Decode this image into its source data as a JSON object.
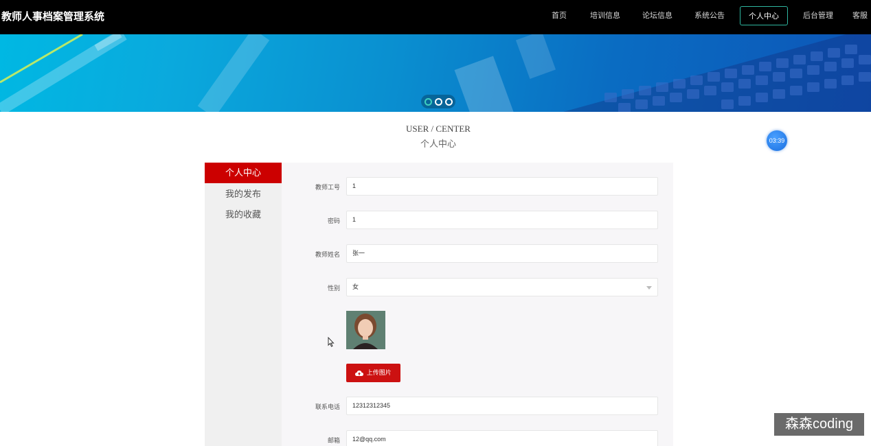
{
  "app": {
    "title": "教师人事档案管理系统"
  },
  "nav": {
    "items": [
      {
        "label": "首页"
      },
      {
        "label": "培训信息"
      },
      {
        "label": "论坛信息"
      },
      {
        "label": "系统公告"
      },
      {
        "label": "个人中心",
        "active": true
      },
      {
        "label": "后台管理"
      },
      {
        "label": "客服"
      }
    ]
  },
  "banner": {
    "slides": 3,
    "active_slide": 1
  },
  "page": {
    "title_en": "USER / CENTER",
    "title_cn": "个人中心"
  },
  "timer": {
    "value": "03:39"
  },
  "sidebar": {
    "items": [
      {
        "label": "个人中心",
        "active": true
      },
      {
        "label": "我的发布"
      },
      {
        "label": "我的收藏"
      }
    ]
  },
  "form": {
    "teacher_id": {
      "label": "教师工号",
      "value": "1"
    },
    "password": {
      "label": "密码",
      "value": "1"
    },
    "name": {
      "label": "教师姓名",
      "value": "张一"
    },
    "gender": {
      "label": "性别",
      "value": "女"
    },
    "upload_label": "上传图片",
    "phone": {
      "label": "联系电话",
      "value": "12312312345"
    },
    "email": {
      "label": "邮箱",
      "value": "12@qq.com"
    }
  },
  "colors": {
    "accent": "#cc0000",
    "nav_active_border": "#2fb7a0",
    "nav_bg": "#000000"
  },
  "watermark": "森森coding"
}
